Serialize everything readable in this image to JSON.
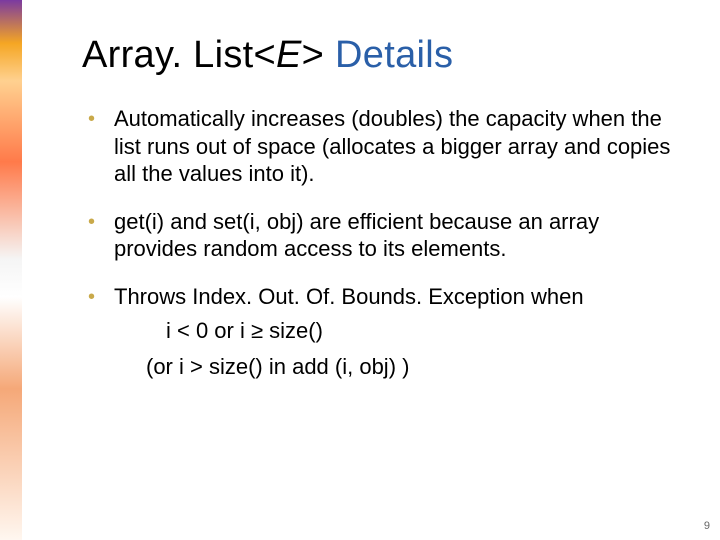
{
  "title": {
    "prefix": "Array. List<",
    "generic": "E",
    "suffix": "> ",
    "details": "Details"
  },
  "bullets": {
    "b1": "Automatically increases (doubles) the capacity when the list runs out of space (allocates a bigger array and copies all the values into it).",
    "b2": "get(i) and set(i, obj) are efficient because an array provides random access to its elements.",
    "b3_a": "Throws Index. Out. Of. Bounds. Exception when",
    "b3_b": "i < 0 or i ≥ size()",
    "b3_c": "(or i > size() in add (i, obj) )"
  },
  "pagenum": "9"
}
